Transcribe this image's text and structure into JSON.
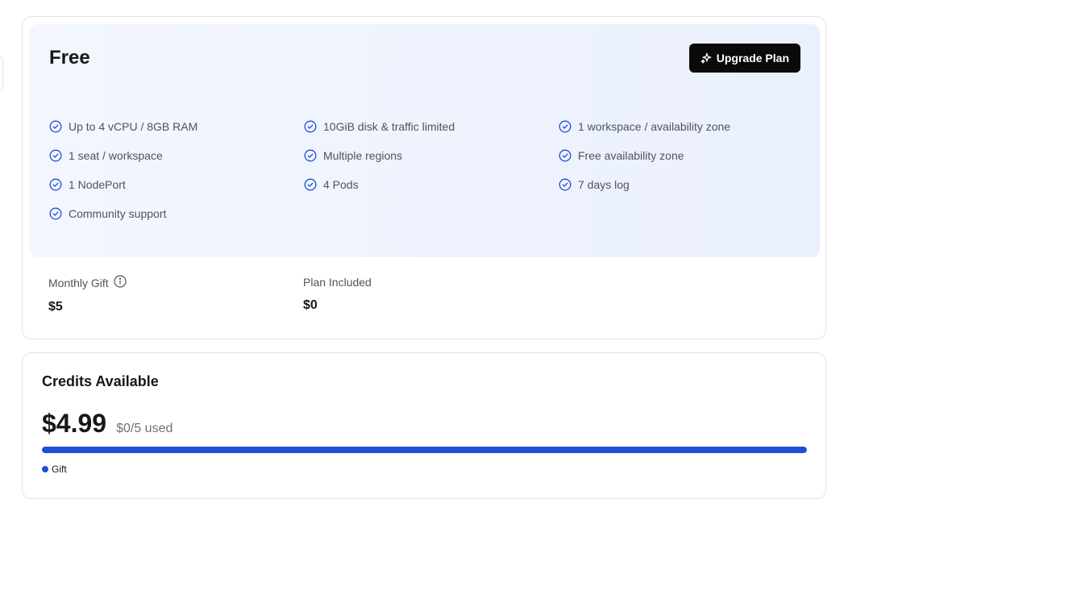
{
  "plan": {
    "name": "Free",
    "upgrade_label": "Upgrade Plan",
    "features": [
      "Up to 4 vCPU / 8GB RAM",
      "10GiB disk & traffic limited",
      "1 workspace / availability zone",
      "1 seat / workspace",
      "Multiple regions",
      "Free availability zone",
      "1 NodePort",
      "4 Pods",
      "7 days log",
      "Community support"
    ],
    "monthly_gift_label": "Monthly Gift",
    "monthly_gift_value": "$5",
    "plan_included_label": "Plan Included",
    "plan_included_value": "$0"
  },
  "credits": {
    "title": "Credits Available",
    "amount": "$4.99",
    "used": "$0/5 used",
    "progress_percent": 100,
    "legend_label": "Gift"
  },
  "colors": {
    "accent": "#1d4ed8",
    "button_bg": "#0a0a0a"
  },
  "icons": {
    "feature": "check-circle-icon",
    "upgrade": "sparkle-icon",
    "info": "info-icon"
  }
}
